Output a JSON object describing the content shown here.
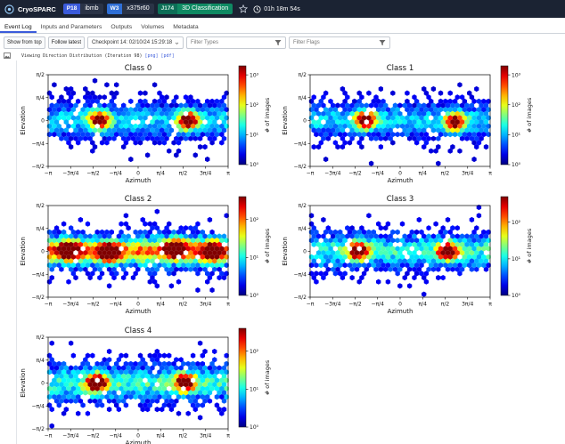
{
  "app": {
    "name": "CryoSPARC"
  },
  "breadcrumbs": [
    {
      "tag": "P18",
      "name": "ibmb"
    },
    {
      "tag": "W3",
      "name": "x375r60"
    },
    {
      "tag": "J174",
      "name": "3D Classification"
    }
  ],
  "timer": "01h 18m 54s",
  "tabs": [
    "Event Log",
    "Inputs and Parameters",
    "Outputs",
    "Volumes",
    "Metadata"
  ],
  "toolbar": {
    "show_from_top": "Show from top",
    "follow_latest": "Follow latest",
    "checkpoint": "Checkpoint 14: 02/10/24 15:29:18",
    "filter_types_placeholder": "Filter Types",
    "filter_flags_placeholder": "Filter Flags"
  },
  "event": {
    "text": "Viewing Direction Distribution (Iteration 98)",
    "links": [
      "[png]",
      "[pdf]"
    ]
  },
  "icons": [
    "cryosparc-logo-icon",
    "star-icon",
    "clock-icon",
    "filter-icon",
    "chevron-down-icon",
    "image-icon"
  ],
  "colors": {
    "topbar": "#1b2333",
    "accent": "#3b5bdb",
    "job_green": "#0f8a63"
  },
  "chart_data": [
    {
      "type": "heatmap",
      "title": "Class 0",
      "xlabel": "Azimuth",
      "ylabel": "Elevation",
      "xticks": [
        "−π",
        "−3π/4",
        "−π/2",
        "−π/4",
        "0",
        "π/4",
        "π/2",
        "3π/4",
        "π"
      ],
      "yticks": [
        "π/2",
        "π/4",
        "0",
        "−π/4",
        "−π/2"
      ],
      "colorbar_label": "# of images",
      "colorbar_ticks": [
        "10⁰",
        "10¹",
        "10²",
        "10³"
      ],
      "colorbar_range": [
        1,
        2000
      ],
      "hotspots": [
        {
          "azimuth": -1.35,
          "elevation": 0.02,
          "count": 1500
        },
        {
          "azimuth": 1.75,
          "elevation": 0.0,
          "count": 1500
        }
      ]
    },
    {
      "type": "heatmap",
      "title": "Class 1",
      "xlabel": "Azimuth",
      "ylabel": "Elevation",
      "xticks": [
        "−π",
        "−3π/4",
        "−π/2",
        "−π/4",
        "0",
        "π/4",
        "π/2",
        "3π/4",
        "π"
      ],
      "yticks": [
        "π/2",
        "π/4",
        "0",
        "−π/4",
        "−π/2"
      ],
      "colorbar_label": "# of images",
      "colorbar_ticks": [
        "10⁰",
        "10¹",
        "10²",
        "10³"
      ],
      "colorbar_range": [
        1,
        2000
      ],
      "hotspots": [
        {
          "azimuth": -1.2,
          "elevation": 0.02,
          "count": 1500
        },
        {
          "azimuth": 1.9,
          "elevation": -0.05,
          "count": 1500
        }
      ]
    },
    {
      "type": "heatmap",
      "title": "Class 2",
      "xlabel": "Azimuth",
      "ylabel": "Elevation",
      "xticks": [
        "−π",
        "−3π/4",
        "−π/2",
        "−π/4",
        "0",
        "π/4",
        "π/2",
        "3π/4",
        "π"
      ],
      "yticks": [
        "π/2",
        "π/4",
        "0",
        "−π/4",
        "−π/2"
      ],
      "colorbar_label": "# of images",
      "colorbar_ticks": [
        "10⁰",
        "10¹",
        "10²"
      ],
      "colorbar_range": [
        1,
        400
      ],
      "hotspots": [
        {
          "azimuth": -2.4,
          "elevation": 0.05,
          "count": 250
        },
        {
          "azimuth": -1.0,
          "elevation": -0.05,
          "count": 250
        },
        {
          "azimuth": 1.3,
          "elevation": 0.1,
          "count": 250
        },
        {
          "azimuth": 2.6,
          "elevation": 0.0,
          "count": 250
        }
      ]
    },
    {
      "type": "heatmap",
      "title": "Class 3",
      "xlabel": "Azimuth",
      "ylabel": "Elevation",
      "xticks": [
        "−π",
        "−3π/4",
        "−π/2",
        "−π/4",
        "0",
        "π/4",
        "π/2",
        "3π/4",
        "π"
      ],
      "yticks": [
        "π/2",
        "π/4",
        "0",
        "−π/4",
        "−π/2"
      ],
      "colorbar_label": "# of images",
      "colorbar_ticks": [
        "10⁰",
        "10¹",
        "10²"
      ],
      "colorbar_range": [
        1,
        500
      ],
      "hotspots": [
        {
          "azimuth": -1.45,
          "elevation": 0.02,
          "count": 400
        },
        {
          "azimuth": 1.65,
          "elevation": 0.0,
          "count": 400
        }
      ]
    },
    {
      "type": "heatmap",
      "title": "Class 4",
      "xlabel": "Azimuth",
      "ylabel": "Elevation",
      "xticks": [
        "−π",
        "−3π/4",
        "−π/2",
        "−π/4",
        "0",
        "π/4",
        "π/2",
        "3π/4",
        "π"
      ],
      "yticks": [
        "π/2",
        "π/4",
        "0",
        "−π/4",
        "−π/2"
      ],
      "colorbar_label": "# of images",
      "colorbar_ticks": [
        "10⁰",
        "10¹",
        "10²"
      ],
      "colorbar_range": [
        1,
        400
      ],
      "hotspots": [
        {
          "azimuth": -1.45,
          "elevation": 0.0,
          "count": 350
        },
        {
          "azimuth": 1.65,
          "elevation": 0.0,
          "count": 350
        }
      ]
    }
  ]
}
